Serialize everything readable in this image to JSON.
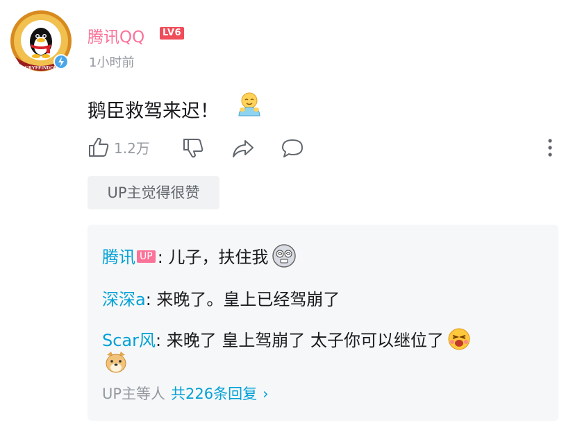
{
  "comment": {
    "username": "腾讯QQ",
    "level_badge": "LV6",
    "time": "1小时前",
    "text": "鹅臣救驾来迟！",
    "like_count": "1.2万",
    "up_tag": "UP主觉得很赞"
  },
  "replies": [
    {
      "name": "腾讯",
      "up_badge": "UP",
      "text": ": 儿子，扶住我"
    },
    {
      "name": "深深a",
      "text": ": 来晚了。皇上已经驾崩了"
    },
    {
      "name": "Scar风",
      "text": ": 来晚了  皇上驾崩了 太子你可以继位了"
    }
  ],
  "footer": {
    "prefix": "UP主等人",
    "total": "共226条回复",
    "chevron": "›"
  },
  "icons": {
    "like": "thumbs-up-icon",
    "dislike": "thumbs-down-icon",
    "share": "share-icon",
    "reply": "comment-icon",
    "more": "more-vertical-icon"
  },
  "colors": {
    "username": "#fb7299",
    "level": "#f04d5b",
    "reply_name": "#00a1d6",
    "muted": "#9499a0"
  }
}
